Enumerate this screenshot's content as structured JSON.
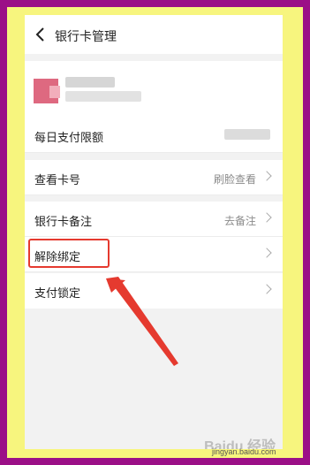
{
  "header": {
    "title": "银行卡管理",
    "back_icon": "chevron-left-icon"
  },
  "rows": [
    {
      "label": "每日支付限额",
      "value": ""
    },
    {
      "label": "查看卡号",
      "value": "刷脸查看"
    },
    {
      "label": "银行卡备注",
      "value": "去备注"
    },
    {
      "label": "解除绑定",
      "value": ""
    },
    {
      "label": "支付锁定",
      "value": ""
    }
  ],
  "colors": {
    "outer_border": "#9b0f87",
    "inner_border": "#f7f57e",
    "highlight": "#e53a2f"
  },
  "watermark": {
    "logo": "Baidu 经验",
    "url": "jingyan.baidu.com"
  }
}
